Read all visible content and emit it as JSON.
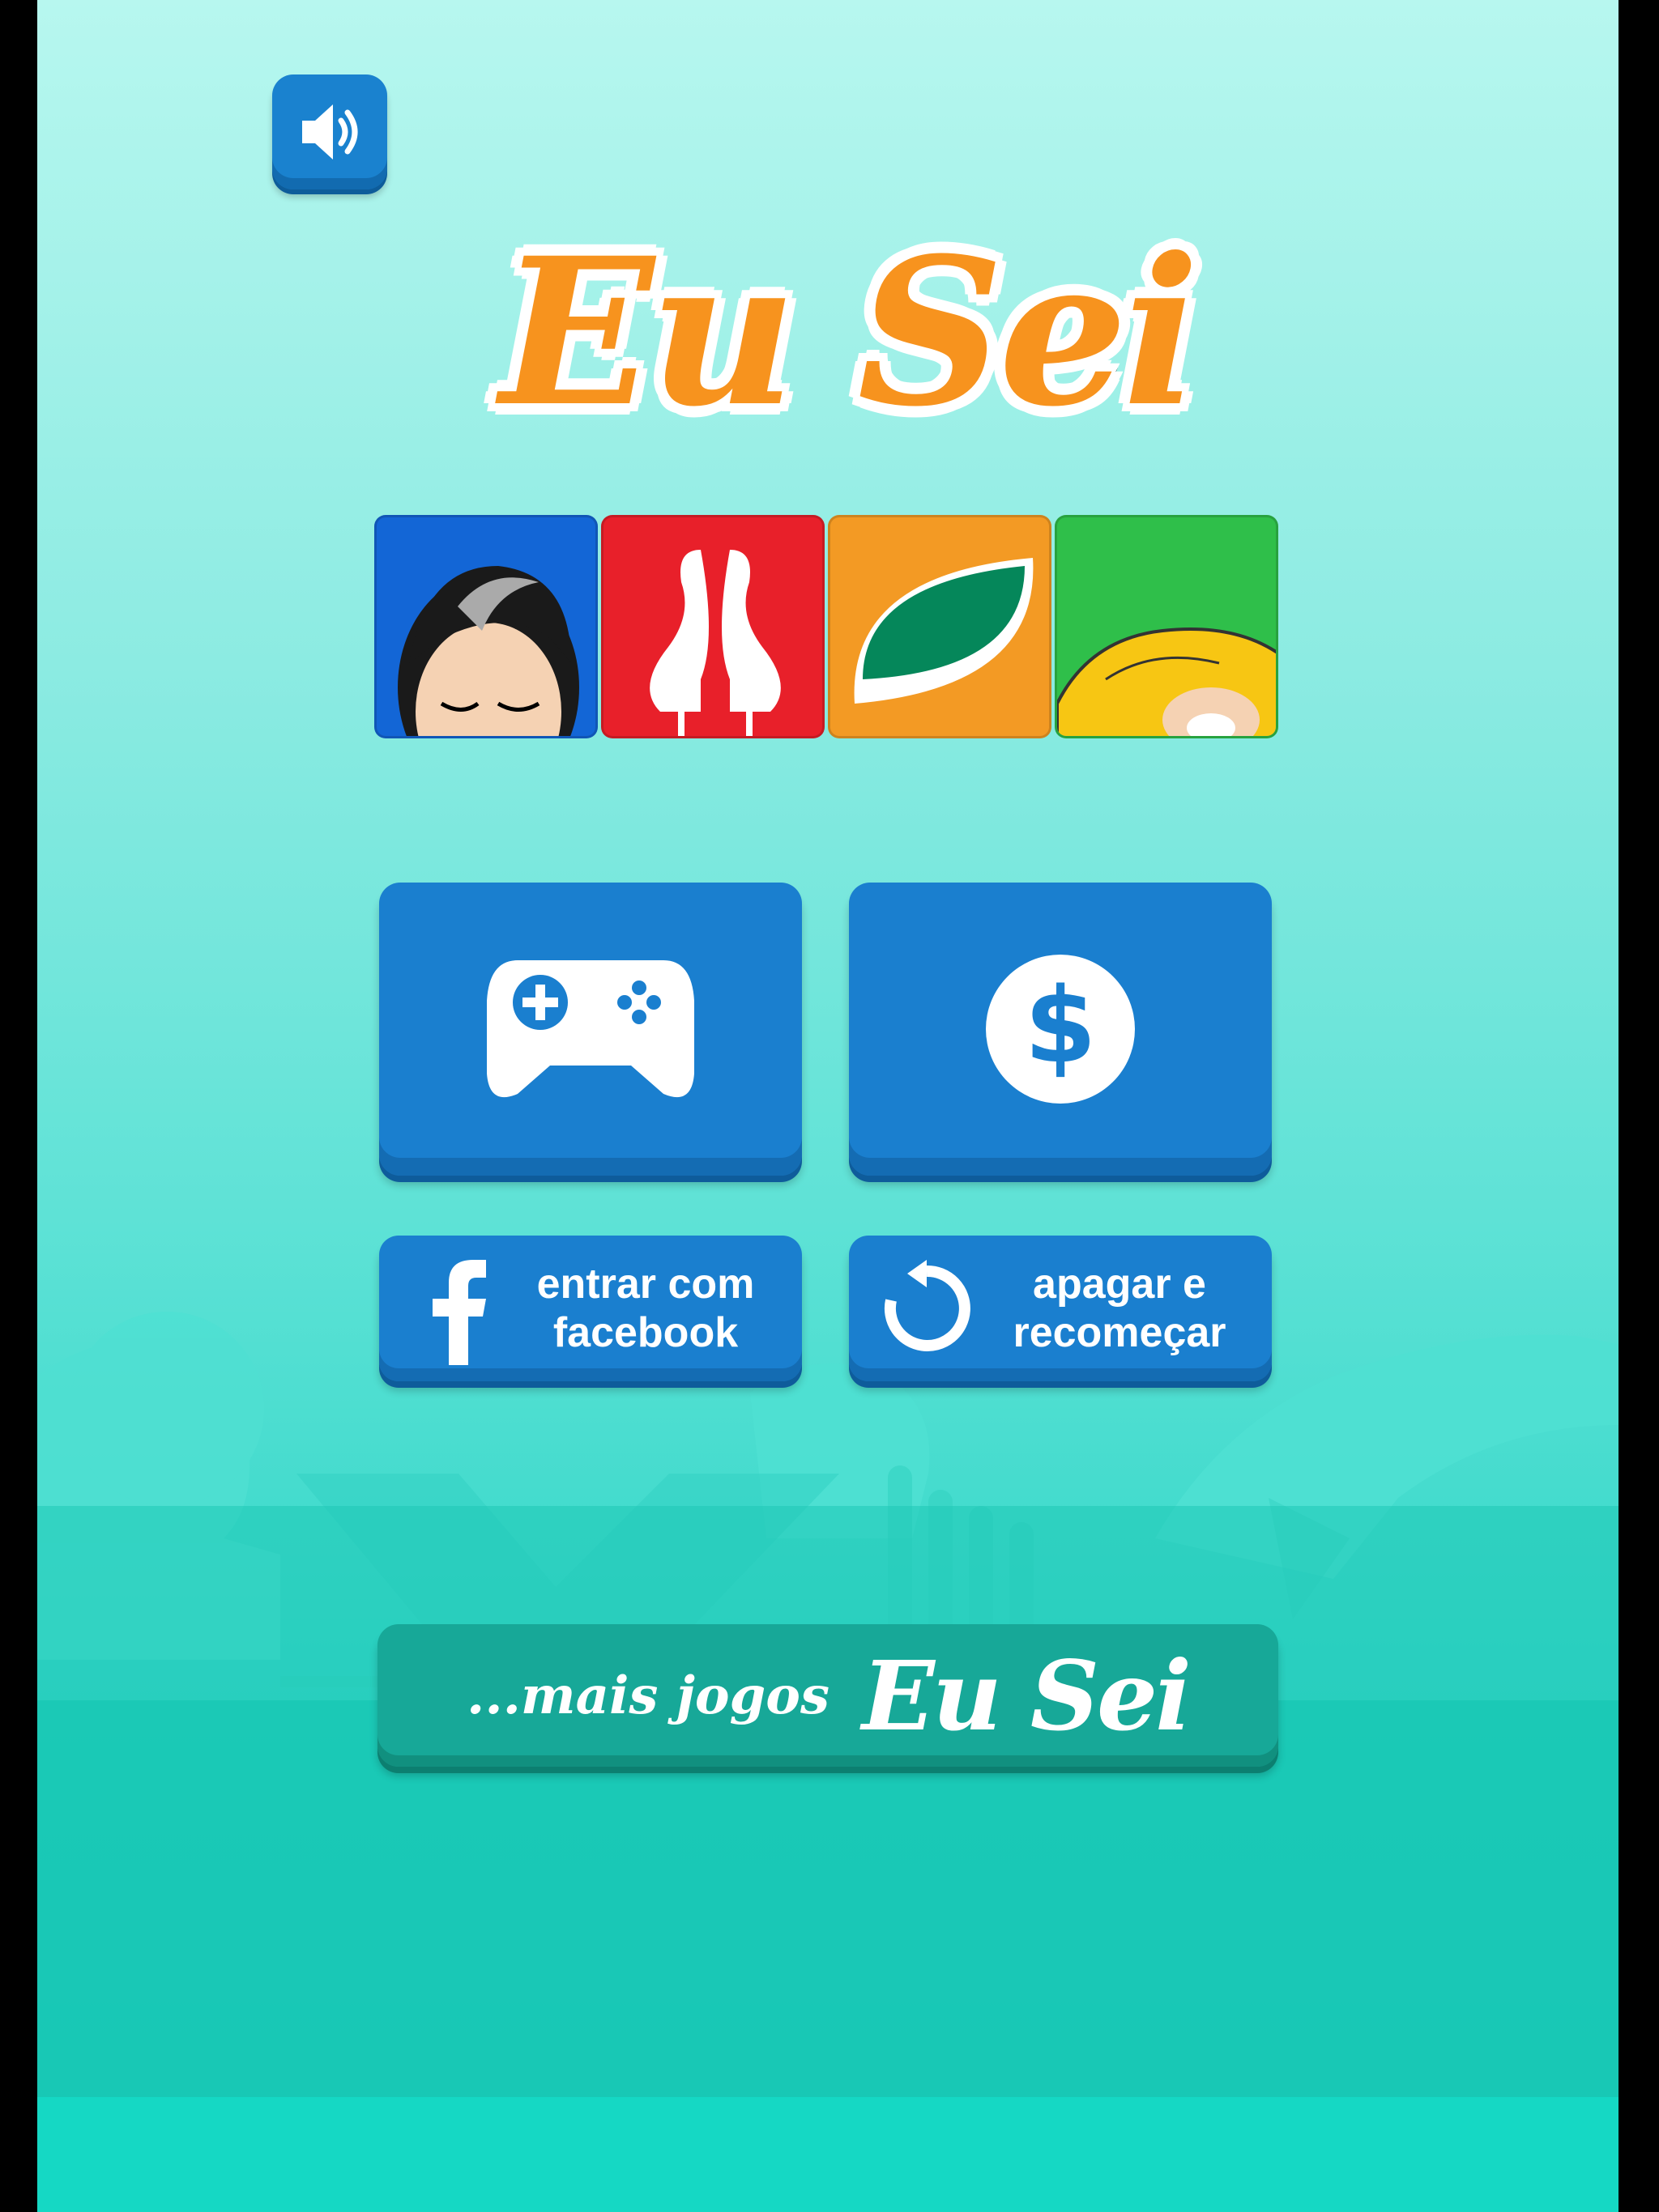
{
  "logo": {
    "title": "Eu Sei"
  },
  "buttons": {
    "facebook_label": "entrar com facebook",
    "reset_label": "apagar e recomeçar",
    "more_prefix": "...mais jogos",
    "more_brand": "Eu Sei"
  },
  "icons": {
    "sound": "speaker-icon",
    "play": "gamepad-icon",
    "store": "dollar-coin-icon",
    "facebook": "facebook-icon",
    "reset": "restart-arrow-icon"
  },
  "colors": {
    "button_blue": "#1a7fcf",
    "logo_orange": "#f7931e",
    "more_button_teal": "#17a898",
    "tile_blue": "#1366d6",
    "tile_red": "#e8202a",
    "tile_orange": "#f39a24",
    "tile_green": "#2fbf4a"
  }
}
